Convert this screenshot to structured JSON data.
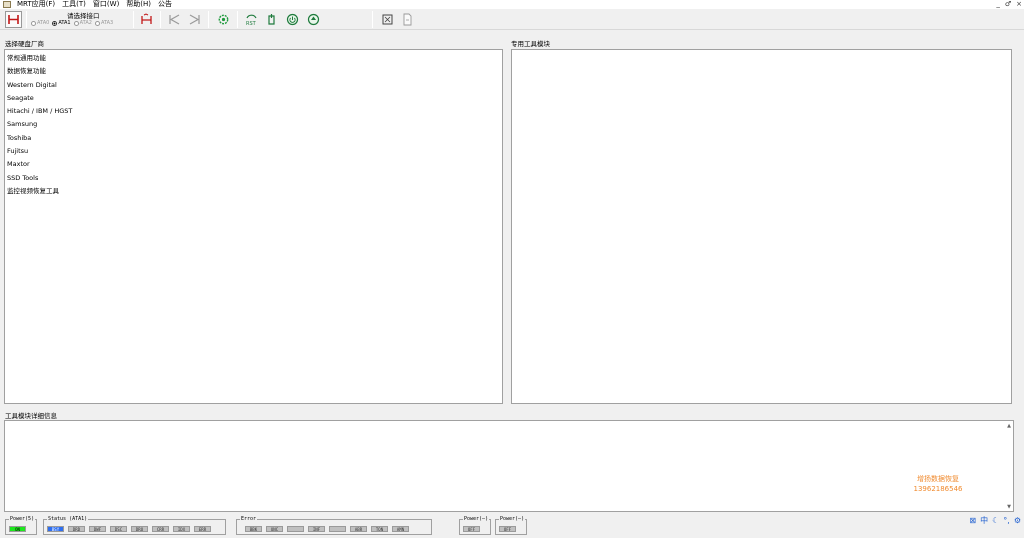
{
  "menu": {
    "items": [
      "MRT应用(F)",
      "工具(T)",
      "窗口(W)",
      "帮助(H)",
      "公告"
    ],
    "window_controls": [
      "_",
      "♂",
      "×"
    ]
  },
  "toolbar": {
    "port_title": "请选择接口",
    "ports": [
      {
        "label": "ATA0",
        "selected": false
      },
      {
        "label": "ATA1",
        "selected": true
      },
      {
        "label": "ATA2",
        "selected": false
      },
      {
        "label": "ATA3",
        "selected": false
      }
    ]
  },
  "left_panel": {
    "title": "选择硬盘厂商",
    "vendors": [
      "常规通用功能",
      "数据恢复功能",
      "Western Digital",
      "Seagate",
      "Hitachi / IBM / HGST",
      "Samsung",
      "Toshiba",
      "Fujitsu",
      "Maxtor",
      "SSD Tools",
      "监控视频恢复工具"
    ]
  },
  "right_panel": {
    "title": "专用工具模块"
  },
  "detail_panel": {
    "title": "工具模块详细信息",
    "watermark_line1": "增扬数据恢复",
    "watermark_line2": "13962186546"
  },
  "status_bar": {
    "power_group": {
      "title": "Power(5)",
      "leds": [
        {
          "label": "ON",
          "state": "green"
        }
      ]
    },
    "status_group": {
      "title": "Status (ATA1)",
      "leds": [
        {
          "label": "BSY",
          "state": "blue"
        },
        {
          "label": "DRD",
          "state": "off"
        },
        {
          "label": "DWF",
          "state": "off"
        },
        {
          "label": "DSC",
          "state": "off"
        },
        {
          "label": "DRQ",
          "state": "off"
        },
        {
          "label": "CRR",
          "state": "off"
        },
        {
          "label": "IDX",
          "state": "off"
        },
        {
          "label": "ERR",
          "state": "off"
        }
      ]
    },
    "error_group": {
      "title": "Error",
      "leds": [
        {
          "label": "BBK",
          "state": "off"
        },
        {
          "label": "UNC",
          "state": "off"
        },
        {
          "label": "",
          "state": "off"
        },
        {
          "label": "INF",
          "state": "off"
        },
        {
          "label": "",
          "state": "off"
        },
        {
          "label": "ABR",
          "state": "off"
        },
        {
          "label": "TON",
          "state": "off"
        },
        {
          "label": "AMN",
          "state": "off"
        }
      ]
    },
    "power2_group": {
      "title": "Power(—)",
      "leds": [
        {
          "label": "OFF",
          "state": "off"
        }
      ]
    },
    "power3_group": {
      "title": "Power(—)",
      "leds": [
        {
          "label": "OFF",
          "state": "off"
        }
      ]
    }
  },
  "tray": {
    "items": [
      {
        "icon": "keyboard-icon",
        "text": "⊠"
      },
      {
        "icon": "chinese-input-icon",
        "text": "中"
      },
      {
        "icon": "moon-icon",
        "text": "☾"
      },
      {
        "icon": "punctuation-icon",
        "text": "°,"
      },
      {
        "icon": "settings-icon",
        "text": "⚙"
      }
    ]
  },
  "colors": {
    "led_green": "#1ee81e",
    "led_blue": "#2f6ff0",
    "watermark": "#f08a2e"
  }
}
